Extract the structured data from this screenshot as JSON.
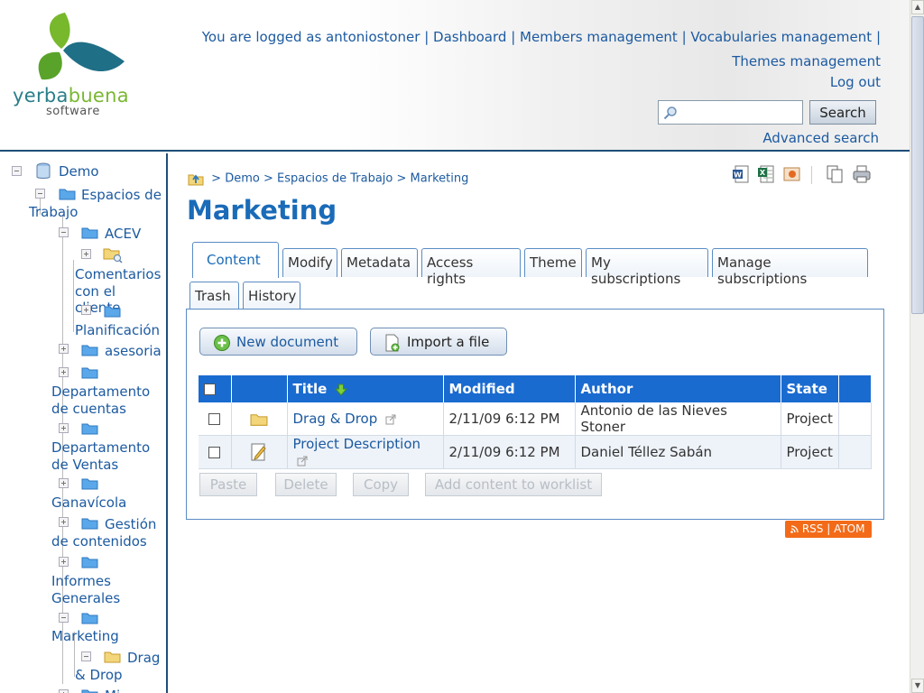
{
  "header": {
    "logo_main_a": "yerba",
    "logo_main_b": "buena",
    "logo_sub": "software",
    "logged_as": "You are logged as antoniostoner",
    "nav": [
      "Dashboard",
      "Members management",
      "Vocabularies management",
      "Themes management"
    ],
    "logout": "Log out",
    "search_placeholder": "",
    "search_button": "Search",
    "advanced_search": "Advanced search"
  },
  "sidebar": {
    "items": [
      "Demo",
      "Espacios de Trabajo",
      "ACEV",
      "Comentarios con el cliente",
      "Planificación",
      "asesoria",
      "Departamento de cuentas",
      "Departamento de Ventas",
      "Ganavícola",
      "Gestión de contenidos",
      "Informes Generales",
      "Marketing",
      "Drag & Drop",
      "Mi"
    ]
  },
  "breadcrumb": {
    "sep": ">",
    "items": [
      "Demo",
      "Espacios de Trabajo",
      "Marketing"
    ]
  },
  "page": {
    "title": "Marketing"
  },
  "tabs": [
    "Content",
    "Modify",
    "Metadata",
    "Access rights",
    "Theme",
    "My subscriptions",
    "Manage subscriptions",
    "Trash",
    "History"
  ],
  "actions": {
    "new_document": "New document",
    "import_file": "Import a file"
  },
  "table": {
    "columns": [
      "Title",
      "Modified",
      "Author",
      "State"
    ],
    "rows": [
      {
        "title": "Drag & Drop",
        "modified": "2/11/09 6:12 PM",
        "author": "Antonio de las Nieves Stoner",
        "state": "Project"
      },
      {
        "title": "Project Description",
        "modified": "2/11/09 6:12 PM",
        "author": "Daniel Téllez Sabán",
        "state": "Project"
      }
    ]
  },
  "bottom_buttons": [
    "Paste",
    "Delete",
    "Copy",
    "Add content to worklist"
  ],
  "rss": "RSS | ATOM",
  "colors": {
    "accent": "#1a6bb8",
    "header_row": "#1a6bd0",
    "rss": "#f36b18"
  }
}
